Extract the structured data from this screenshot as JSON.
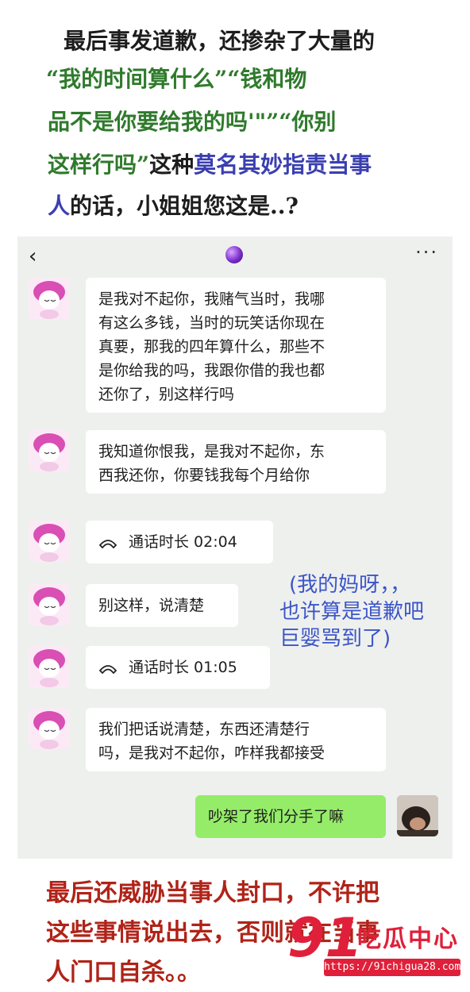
{
  "colors": {
    "caption_black": "#1d1d1d",
    "caption_green": "#2f7a2c",
    "caption_blue": "#3a3fb0",
    "caption_red": "#b02318",
    "chat_bg": "#eef0ee",
    "sent_bubble": "#95ec69",
    "annotation": "#3c55c8",
    "watermark": "#e0203a"
  },
  "top_caption": {
    "l1": "最后事发道歉，还掺杂了大量的",
    "l2": "“我的时间算什么”“钱和物",
    "l3": "品不是你要给我的吗'\"”“你别",
    "l4a": "这样行吗”",
    "l4b": "这种",
    "l4c": "莫名其妙指责当事",
    "l5a": "人",
    "l5b": "的话，小姐姐您这是..?"
  },
  "chat": {
    "back_icon": "‹",
    "more_icon": "···",
    "messages": [
      {
        "lines": [
          "是我对不起你，我赌气当时，我哪",
          "有这么多钱，当时的玩笑话你现在",
          "真要，那我的四年算什么，那些不",
          "是你给我的吗，我跟你借的我也都",
          "还你了，别这样行吗"
        ]
      },
      {
        "lines": [
          "我知道你恨我，是我对不起你，东",
          "西我还你，你要钱我每个月给你"
        ]
      },
      {
        "call": "通话时长 02:04"
      },
      {
        "lines": [
          "别这样，说清楚"
        ]
      },
      {
        "call": "通话时长 01:05"
      },
      {
        "lines": [
          "我们把话说清楚，东西还清楚行",
          "吗，是我对不起你，咋样我都接受"
        ]
      },
      {
        "sent": "吵架了我们分手了嘛"
      }
    ]
  },
  "annotation": {
    "l1": "(我的妈呀，，",
    "l2": "也许算是道歉吧",
    "l3": "巨婴骂到了)"
  },
  "bottom_caption": {
    "l1": "最后还威胁当事人封口，不许把",
    "l2": "这些事情说出去，否则就在当事",
    "l3": "人门口自杀。。"
  },
  "watermark": {
    "number": "91",
    "name": "吃瓜中心",
    "url": "https://91chigua28.com"
  }
}
